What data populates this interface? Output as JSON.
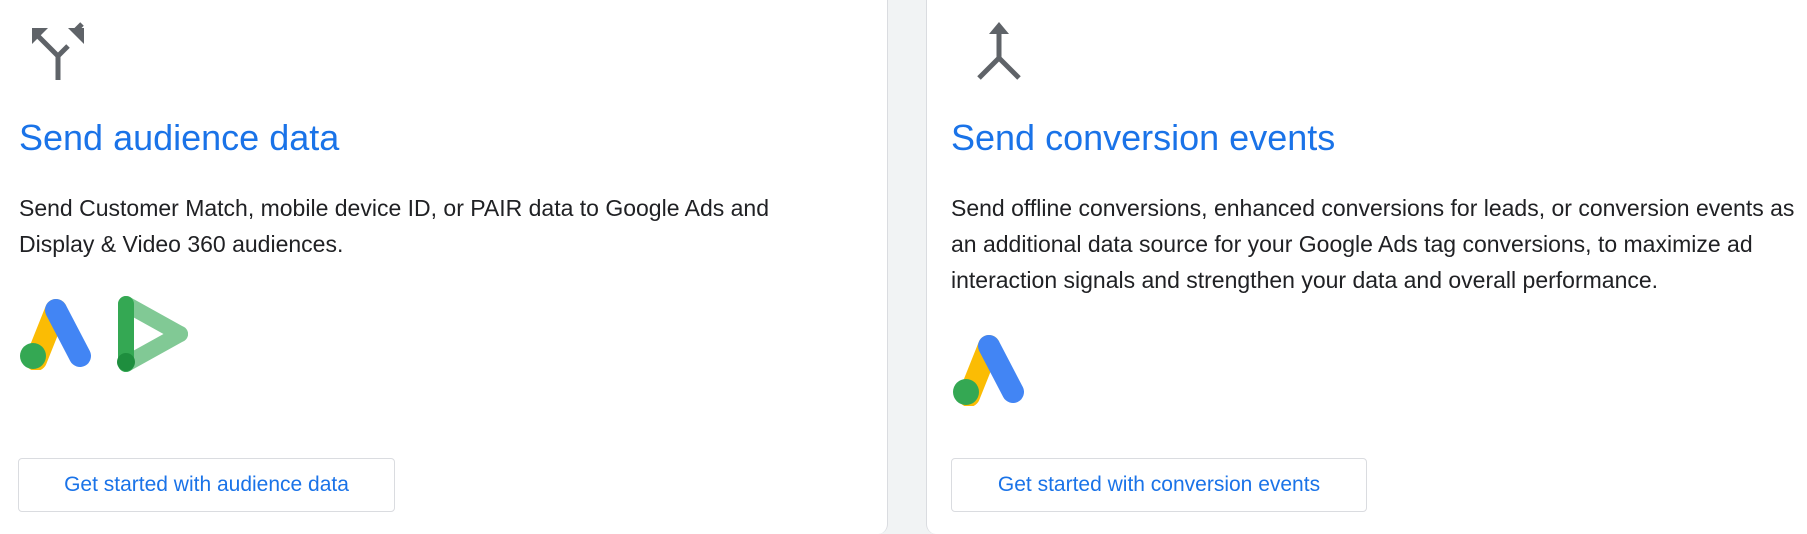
{
  "cards": {
    "audience": {
      "icon": "fork-arrows-icon",
      "title": "Send audience data",
      "description": "Send Customer Match, mobile device ID, or PAIR data to Google Ads and Display & Video 360 audiences.",
      "logos": [
        "google-ads-logo",
        "display-video-360-logo"
      ],
      "button_label": "Get started with audience data"
    },
    "conversion": {
      "icon": "merge-arrows-icon",
      "title": "Send conversion events",
      "description": "Send offline conversions, enhanced conversions for leads, or conversion events as an additional data source for your Google Ads tag conversions, to maximize ad interaction signals and strengthen your data and overall performance.",
      "logos": [
        "google-ads-logo"
      ],
      "button_label": "Get started with conversion events"
    }
  },
  "colors": {
    "accent": "#1a73e8",
    "icon_gray": "#5f6368",
    "text": "#202124",
    "border": "#dadce0",
    "page_bg": "#f1f3f4",
    "google_blue": "#4285f4",
    "google_yellow": "#fbbc04",
    "google_green": "#34a853",
    "dv360_green": "#34a853",
    "dv360_light_green": "#81c995",
    "dv360_dark_green": "#1e8e3e"
  }
}
